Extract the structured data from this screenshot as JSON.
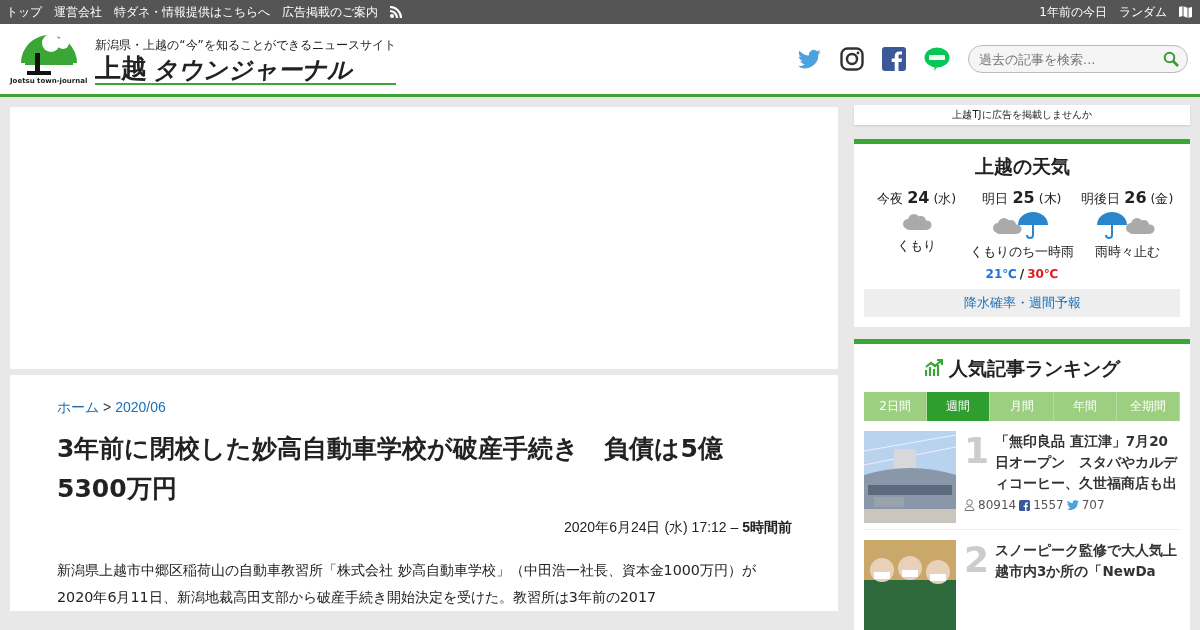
{
  "top_nav": {
    "left": [
      "トップ",
      "運営会社",
      "特ダネ・情報提供はこちらへ",
      "広告掲載のご案内"
    ],
    "right": [
      "1年前の今日",
      "ランダム"
    ]
  },
  "header": {
    "tagline": "新潟県・上越の“今”を知ることができるニュースサイト",
    "logo_small": "Joetsu town-journal",
    "logo_kanji": "上越",
    "logo_kana": "タウンジャーナル",
    "search": {
      "placeholder": "過去の記事を検索..."
    }
  },
  "article": {
    "breadcrumb": [
      {
        "label": "ホーム"
      },
      {
        "label": "2020/06"
      }
    ],
    "breadcrumb_separator": ">",
    "title": "3年前に閉校した妙高自動車学校が破産手続き　負債は5億5300万円",
    "date": "2020年6月24日 (水) 17:12 – ",
    "age": "5時間前",
    "body": "新潟県上越市中郷区稲荷山の自動車教習所「株式会社 妙高自動車学校」（中田浩一社長、資本金1000万円）が2020年6月11日、新潟地裁高田支部から破産手続き開始決定を受けた。教習所は3年前の2017"
  },
  "sidebar": {
    "ad_link": "上越TJに広告を掲載しませんか",
    "weather": {
      "title": "上越の天気",
      "days": [
        {
          "label": "今夜",
          "date": "24",
          "weekday": "(水)",
          "kind": "cloudy",
          "forecast": "くもり"
        },
        {
          "label": "明日",
          "date": "25",
          "weekday": "(木)",
          "kind": "cloudy-rain",
          "forecast": "くもりのち一時雨",
          "low": "21℃",
          "separator": "/",
          "high": "30℃"
        },
        {
          "label": "明後日",
          "date": "26",
          "weekday": "(金)",
          "kind": "rain-cloudy",
          "forecast": "雨時々止む"
        }
      ],
      "link": "降水確率・週間予報"
    },
    "ranking": {
      "title": "人気記事ランキング",
      "tabs": [
        {
          "label": "2日間",
          "selected": false
        },
        {
          "label": "週間",
          "selected": true
        },
        {
          "label": "月間",
          "selected": false
        },
        {
          "label": "年間",
          "selected": false
        },
        {
          "label": "全期間",
          "selected": false
        }
      ],
      "items": [
        {
          "rank": "1",
          "title": "「無印良品 直江津」7月20日オープン　スタバやカルディコーヒー、久世福商店も出",
          "views": "80914",
          "likes": "1557",
          "tweets": "707"
        },
        {
          "rank": "2",
          "title": "スノーピーク監修で大人気上越市内3か所の「NewDa"
        }
      ]
    }
  }
}
